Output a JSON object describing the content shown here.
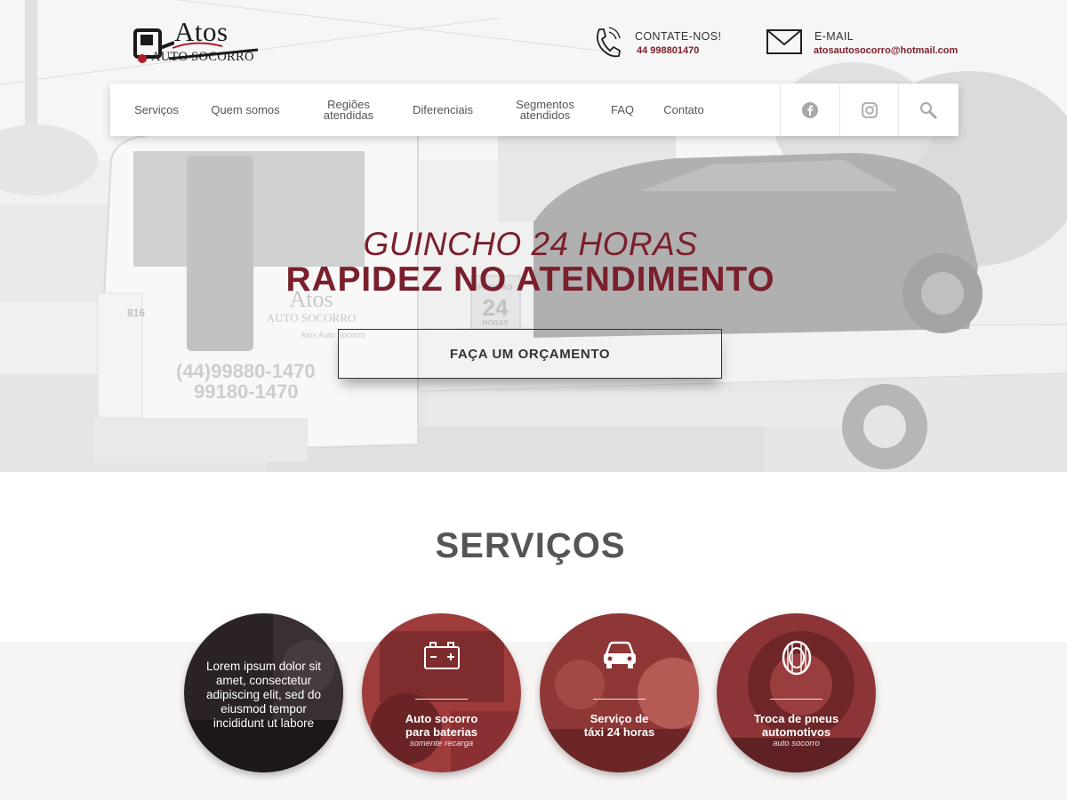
{
  "brand": {
    "name": "Atos",
    "subtitle": "AUTO SOCORRO",
    "accent_color": "#7a1f2c"
  },
  "header": {
    "phone": {
      "icon": "phone-icon",
      "label": "CONTATE-NOS!",
      "value": "44 998801470"
    },
    "email": {
      "icon": "envelope-icon",
      "label": "E-MAIL",
      "value": "atosautosocorro@hotmail.com"
    }
  },
  "nav": {
    "items": [
      {
        "label": "Serviços"
      },
      {
        "label": "Quem somos"
      },
      {
        "label": "Regiões\natendidas"
      },
      {
        "label": "Diferenciais"
      },
      {
        "label": "Segmentos\natendidos"
      },
      {
        "label": "FAQ"
      },
      {
        "label": "Contato"
      }
    ],
    "icons": [
      "facebook-icon",
      "instagram-icon",
      "search-icon"
    ]
  },
  "hero": {
    "line1": "GUINCHO 24 HORAS",
    "line2": "RAPIDEZ NO ATENDIMENTO",
    "cta": "FAÇA UM ORÇAMENTO",
    "truck": {
      "logo": "Atos",
      "logo_sub": "AUTO SOCORRO",
      "social": "Atos Auto Socorro",
      "phone1": "(44)99880-1470",
      "phone2": "99180-1470",
      "badge_top": "PLANTÃO",
      "badge_num": "24",
      "badge_bottom": "HORAS",
      "cab_number": "816"
    }
  },
  "services": {
    "title": "SERVIÇOS",
    "cards": [
      {
        "text": "Lorem ipsum dolor sit amet, consectetur adipiscing elit, sed do eiusmod tempor incididunt ut labore"
      },
      {
        "icon": "battery-icon",
        "title": "Auto socorro\npara baterias",
        "subtitle": "somente recarga"
      },
      {
        "icon": "car-icon",
        "title": "Serviço de\ntáxi 24 horas",
        "subtitle": ""
      },
      {
        "icon": "tire-icon",
        "title": "Troca de pneus\nautomotivos",
        "subtitle": "auto socorro"
      }
    ]
  }
}
